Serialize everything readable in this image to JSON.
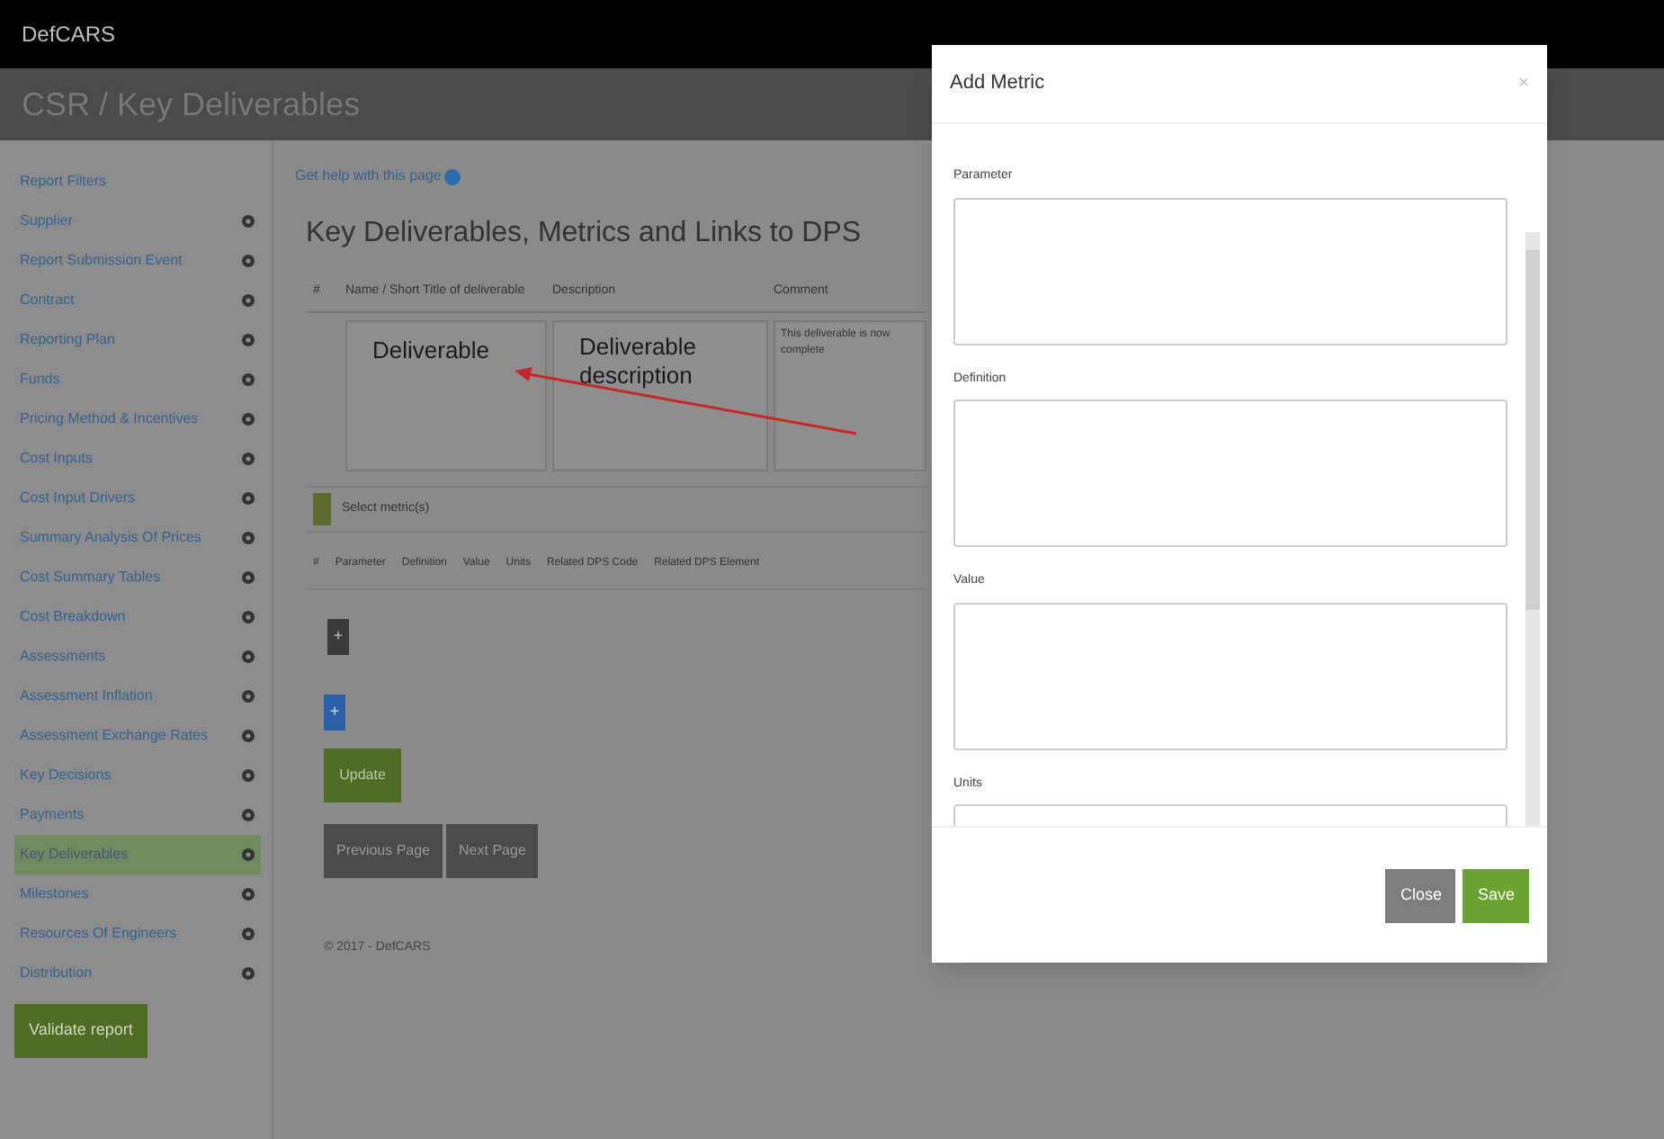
{
  "app": {
    "brand": "DefCARS",
    "page_title": "CSR / Key Deliverables"
  },
  "sidebar": {
    "items": [
      {
        "label": "Report Filters",
        "kind": "plain",
        "selected": false
      },
      {
        "label": "Supplier",
        "kind": "status",
        "selected": false
      },
      {
        "label": "Report Submission Event",
        "kind": "status",
        "selected": false
      },
      {
        "label": "Contract",
        "kind": "status",
        "selected": false
      },
      {
        "label": "Reporting Plan",
        "kind": "status",
        "selected": false
      },
      {
        "label": "Funds",
        "kind": "status",
        "selected": false
      },
      {
        "label": "Pricing Method & Incentives",
        "kind": "status",
        "selected": false
      },
      {
        "label": "Cost Inputs",
        "kind": "status",
        "selected": false
      },
      {
        "label": "Cost Input Drivers",
        "kind": "status",
        "selected": false
      },
      {
        "label": "Summary Analysis Of Prices",
        "kind": "status",
        "selected": false
      },
      {
        "label": "Cost Summary Tables",
        "kind": "status",
        "selected": false
      },
      {
        "label": "Cost Breakdown",
        "kind": "status",
        "selected": false
      },
      {
        "label": "Assessments",
        "kind": "status",
        "selected": false
      },
      {
        "label": "Assessment Inflation",
        "kind": "status",
        "selected": false
      },
      {
        "label": "Assessment Exchange Rates",
        "kind": "status",
        "selected": false
      },
      {
        "label": "Key Decisions",
        "kind": "status",
        "selected": false
      },
      {
        "label": "Payments",
        "kind": "status",
        "selected": false
      },
      {
        "label": "Key Deliverables",
        "kind": "status",
        "selected": true
      },
      {
        "label": "Milestones",
        "kind": "status",
        "selected": false
      },
      {
        "label": "Resources Of Engineers",
        "kind": "status",
        "selected": false
      },
      {
        "label": "Distribution",
        "kind": "status",
        "selected": false
      }
    ],
    "validate_button": "Validate report"
  },
  "content": {
    "help_link": "Get help with this page",
    "heading": "Key Deliverables, Metrics and Links to DPS",
    "deliverables_table": {
      "columns": [
        "#",
        "Name / Short Title of deliverable",
        "Description",
        "Comment"
      ],
      "rows": [
        {
          "cells": [
            "",
            "Deliverable",
            "Deliverable description",
            "This deliverable is now complete"
          ]
        }
      ]
    },
    "select_metrics": "Select metric(s)",
    "metrics_table": {
      "columns": [
        "#",
        "Parameter",
        "Definition",
        "Value",
        "Units",
        "Related DPS Code",
        "Related DPS Element"
      ]
    },
    "add_metric_button": "+",
    "add_deliverable_button": "+",
    "update_button": "Update",
    "nav_buttons": [
      "Previous Page",
      "Next Page"
    ],
    "footer": "© 2017 - DefCARS"
  },
  "modal": {
    "title": "Add Metric",
    "close_icon": "×",
    "fields": [
      {
        "label": "Parameter"
      },
      {
        "label": "Definition"
      },
      {
        "label": "Value"
      },
      {
        "label": "Units"
      }
    ],
    "buttons": [
      {
        "label": "Close",
        "kind": "secondary"
      },
      {
        "label": "Save",
        "kind": "primary"
      }
    ]
  }
}
